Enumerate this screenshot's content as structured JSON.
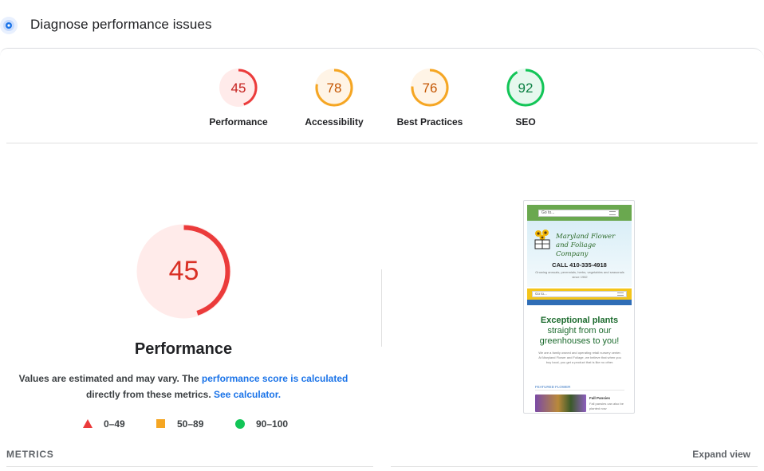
{
  "header": {
    "icon": "diagnose-icon",
    "title": "Diagnose performance issues"
  },
  "colors": {
    "fail": "#eb3b3b",
    "average": "#f5a623",
    "pass": "#12c557",
    "link": "#1a73e8"
  },
  "scores": [
    {
      "label": "Performance",
      "value": "45",
      "score": 45,
      "rating": "fail"
    },
    {
      "label": "Accessibility",
      "value": "78",
      "score": 78,
      "rating": "average"
    },
    {
      "label": "Best Practices",
      "value": "76",
      "score": 76,
      "rating": "average"
    },
    {
      "label": "SEO",
      "value": "92",
      "score": 92,
      "rating": "pass"
    }
  ],
  "performance": {
    "score_text": "45",
    "score": 45,
    "title": "Performance",
    "desc_1": "Values are estimated and may vary. The ",
    "desc_link_1": "performance score is calculated",
    "desc_2": "directly from these metrics. ",
    "desc_link_2": "See calculator."
  },
  "legend": [
    {
      "range": "0–49",
      "shape": "triangle"
    },
    {
      "range": "50–89",
      "shape": "square"
    },
    {
      "range": "90–100",
      "shape": "circle"
    }
  ],
  "screenshot": {
    "nav_text": "Go to...",
    "brand_line1": "Maryland Flower",
    "brand_line2": "and Foliage Company",
    "phone": "CALL 410-335-4918",
    "tagline": "Growing annuals, perennials, herbs, vegetables and seasonals since 1982",
    "nav2_text": "Go to...",
    "headline_bold": "Exceptional plants",
    "headline_rest": "straight from our greenhouses to you!",
    "paragraph": "We are a family owned and operating retail nursery center. At Maryland Flower and Foliage, we believe that when you buy local, you get a product that is like no other.",
    "featured_label": "FEATURED FLOWER",
    "featured_title": "Fall Pansies",
    "featured_text": "Fall pansies can also be planted now"
  },
  "footer": {
    "metrics_label": "METRICS",
    "expand_label": "Expand view"
  }
}
